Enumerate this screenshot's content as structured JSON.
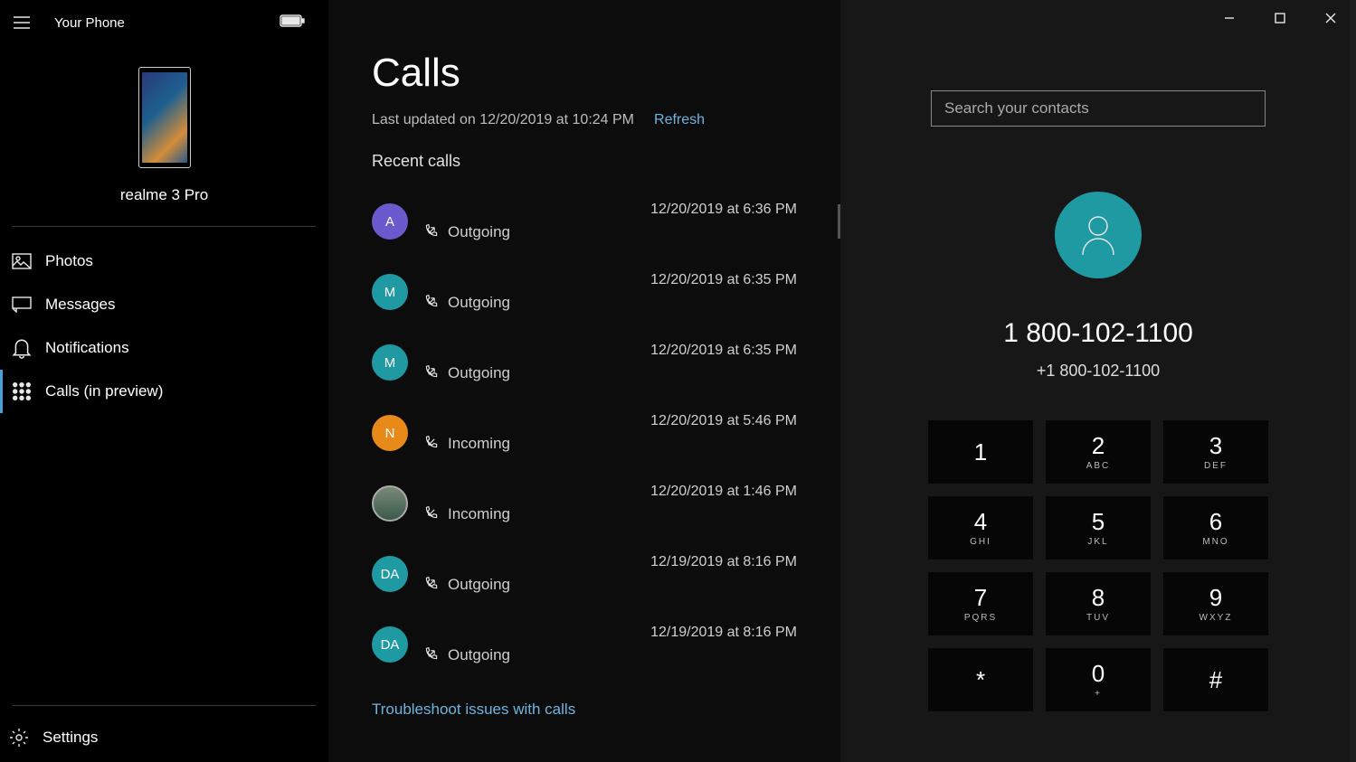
{
  "app": {
    "title": "Your Phone"
  },
  "phone": {
    "name": "realme 3 Pro"
  },
  "nav": {
    "photos": "Photos",
    "messages": "Messages",
    "notifications": "Notifications",
    "calls": "Calls (in preview)",
    "settings": "Settings"
  },
  "calls": {
    "title": "Calls",
    "last_updated": "Last updated on 12/20/2019 at 10:24 PM",
    "refresh": "Refresh",
    "recent_label": "Recent calls",
    "troubleshoot": "Troubleshoot issues with calls",
    "items": [
      {
        "initial": "A",
        "color": "#6a5acd",
        "time": "12/20/2019 at 6:36 PM",
        "dir": "Outgoing"
      },
      {
        "initial": "M",
        "color": "#1f9aa3",
        "time": "12/20/2019 at 6:35 PM",
        "dir": "Outgoing"
      },
      {
        "initial": "M",
        "color": "#1f9aa3",
        "time": "12/20/2019 at 6:35 PM",
        "dir": "Outgoing"
      },
      {
        "initial": "N",
        "color": "#e88a1a",
        "time": "12/20/2019 at 5:46 PM",
        "dir": "Incoming"
      },
      {
        "initial": "",
        "color": "img",
        "time": "12/20/2019 at 1:46 PM",
        "dir": "Incoming"
      },
      {
        "initial": "DA",
        "color": "#1f9aa3",
        "time": "12/19/2019 at 8:16 PM",
        "dir": "Outgoing"
      },
      {
        "initial": "DA",
        "color": "#1f9aa3",
        "time": "12/19/2019 at 8:16 PM",
        "dir": "Outgoing"
      }
    ]
  },
  "dialer": {
    "search_placeholder": "Search your contacts",
    "number_display": "1 800-102-1100",
    "number_full": "+1 800-102-1100",
    "keys": [
      {
        "n": "1",
        "s": ""
      },
      {
        "n": "2",
        "s": "ABC"
      },
      {
        "n": "3",
        "s": "DEF"
      },
      {
        "n": "4",
        "s": "GHI"
      },
      {
        "n": "5",
        "s": "JKL"
      },
      {
        "n": "6",
        "s": "MNO"
      },
      {
        "n": "7",
        "s": "PQRS"
      },
      {
        "n": "8",
        "s": "TUV"
      },
      {
        "n": "9",
        "s": "WXYZ"
      },
      {
        "n": "*",
        "s": ""
      },
      {
        "n": "0",
        "s": "+"
      },
      {
        "n": "#",
        "s": ""
      }
    ]
  }
}
